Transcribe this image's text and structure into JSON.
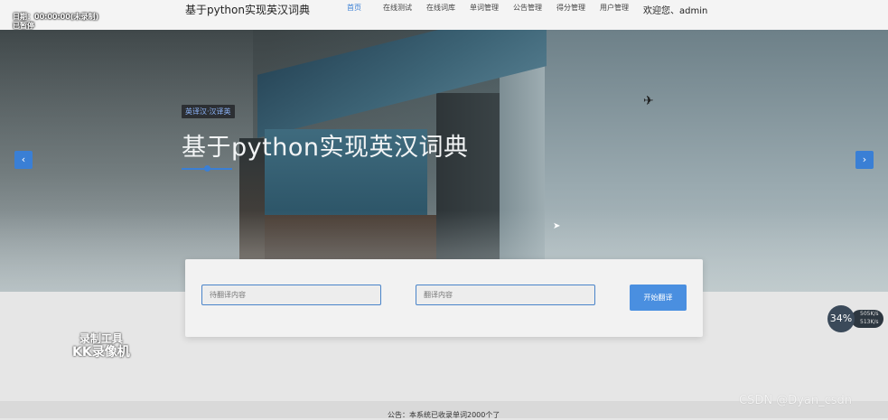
{
  "recorder": {
    "time": "日期：00:00:00(未录制)",
    "status": "已暂停",
    "watermark_line1": "录制工具",
    "watermark_line2": "KK录像机",
    "speed_percent": "34%",
    "upload": "505K/s",
    "download": "513K/s"
  },
  "header": {
    "brand": "基于python实现英汉词典",
    "nav": [
      "首页",
      "在线测试",
      "在线词库",
      "单词管理",
      "公告管理",
      "得分管理",
      "用户管理"
    ],
    "active_nav": "首页",
    "welcome": "欢迎您、admin"
  },
  "hero": {
    "tag": "英译汉·汉译英",
    "title": "基于python实现英汉词典",
    "prev": "‹",
    "next": "›"
  },
  "translate": {
    "source_placeholder": "待翻译内容",
    "target_placeholder": "翻译内容",
    "button": "开始翻译"
  },
  "footer": {
    "notice": "公告：本系统已收录单词2000个了",
    "credit": "CSDN @Dyan_csdn"
  },
  "colors": {
    "accent": "#3a7fd5",
    "button": "#4a8fe0"
  }
}
